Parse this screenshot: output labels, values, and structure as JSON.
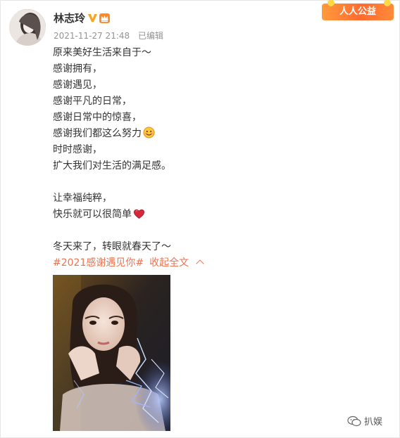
{
  "user": {
    "name": "林志玲",
    "timestamp": "2021-11-27 21:48",
    "edited": "已编辑"
  },
  "badge": {
    "label": "人人公益"
  },
  "post": {
    "lines": [
      "原来美好生活来自于～",
      "感谢拥有，",
      "感谢遇见，",
      "感谢平凡的日常，",
      "感谢日常中的惊喜，",
      "感谢我们都这么努力",
      "时时感谢，",
      "扩大我们对生活的满足感。",
      "",
      "让幸福纯粹，",
      "快乐就可以很简单",
      "",
      "冬天来了，转眼就春天了～"
    ],
    "hashtag": "#2021感谢遇见你#",
    "collapse": "收起全文"
  },
  "icons": {
    "verified": "verified-v-icon",
    "member": "member-crown-icon",
    "smile": "smiling-face-icon",
    "heart": "red-heart-icon",
    "chevron": "chevron-up-icon"
  },
  "watermark": {
    "label": "扒娱"
  },
  "colors": {
    "accent": "#eb7350",
    "meta": "#939393",
    "verified": "#f6a623"
  }
}
